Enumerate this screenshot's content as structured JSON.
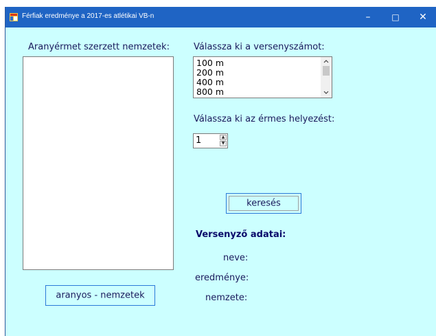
{
  "window": {
    "title": "Férfiak eredménye a 2017-es atlétikai VB-n",
    "minimize": "–",
    "maximize": "□",
    "close": "✕"
  },
  "left": {
    "heading": "Aranyérmet szerzett nemzetek:",
    "button": "aranyos - nemzetek"
  },
  "event": {
    "label": "Válassza ki a versenyszámot:",
    "options": [
      "100 m",
      "200 m",
      "400 m",
      "800 m"
    ]
  },
  "place": {
    "label": "Válassza ki az érmes helyezést:",
    "value": "1"
  },
  "search": {
    "button": "keresés"
  },
  "athlete": {
    "heading": "Versenyző adatai:",
    "name_label": "neve:",
    "result_label": "eredménye:",
    "nation_label": "nemzete:"
  }
}
